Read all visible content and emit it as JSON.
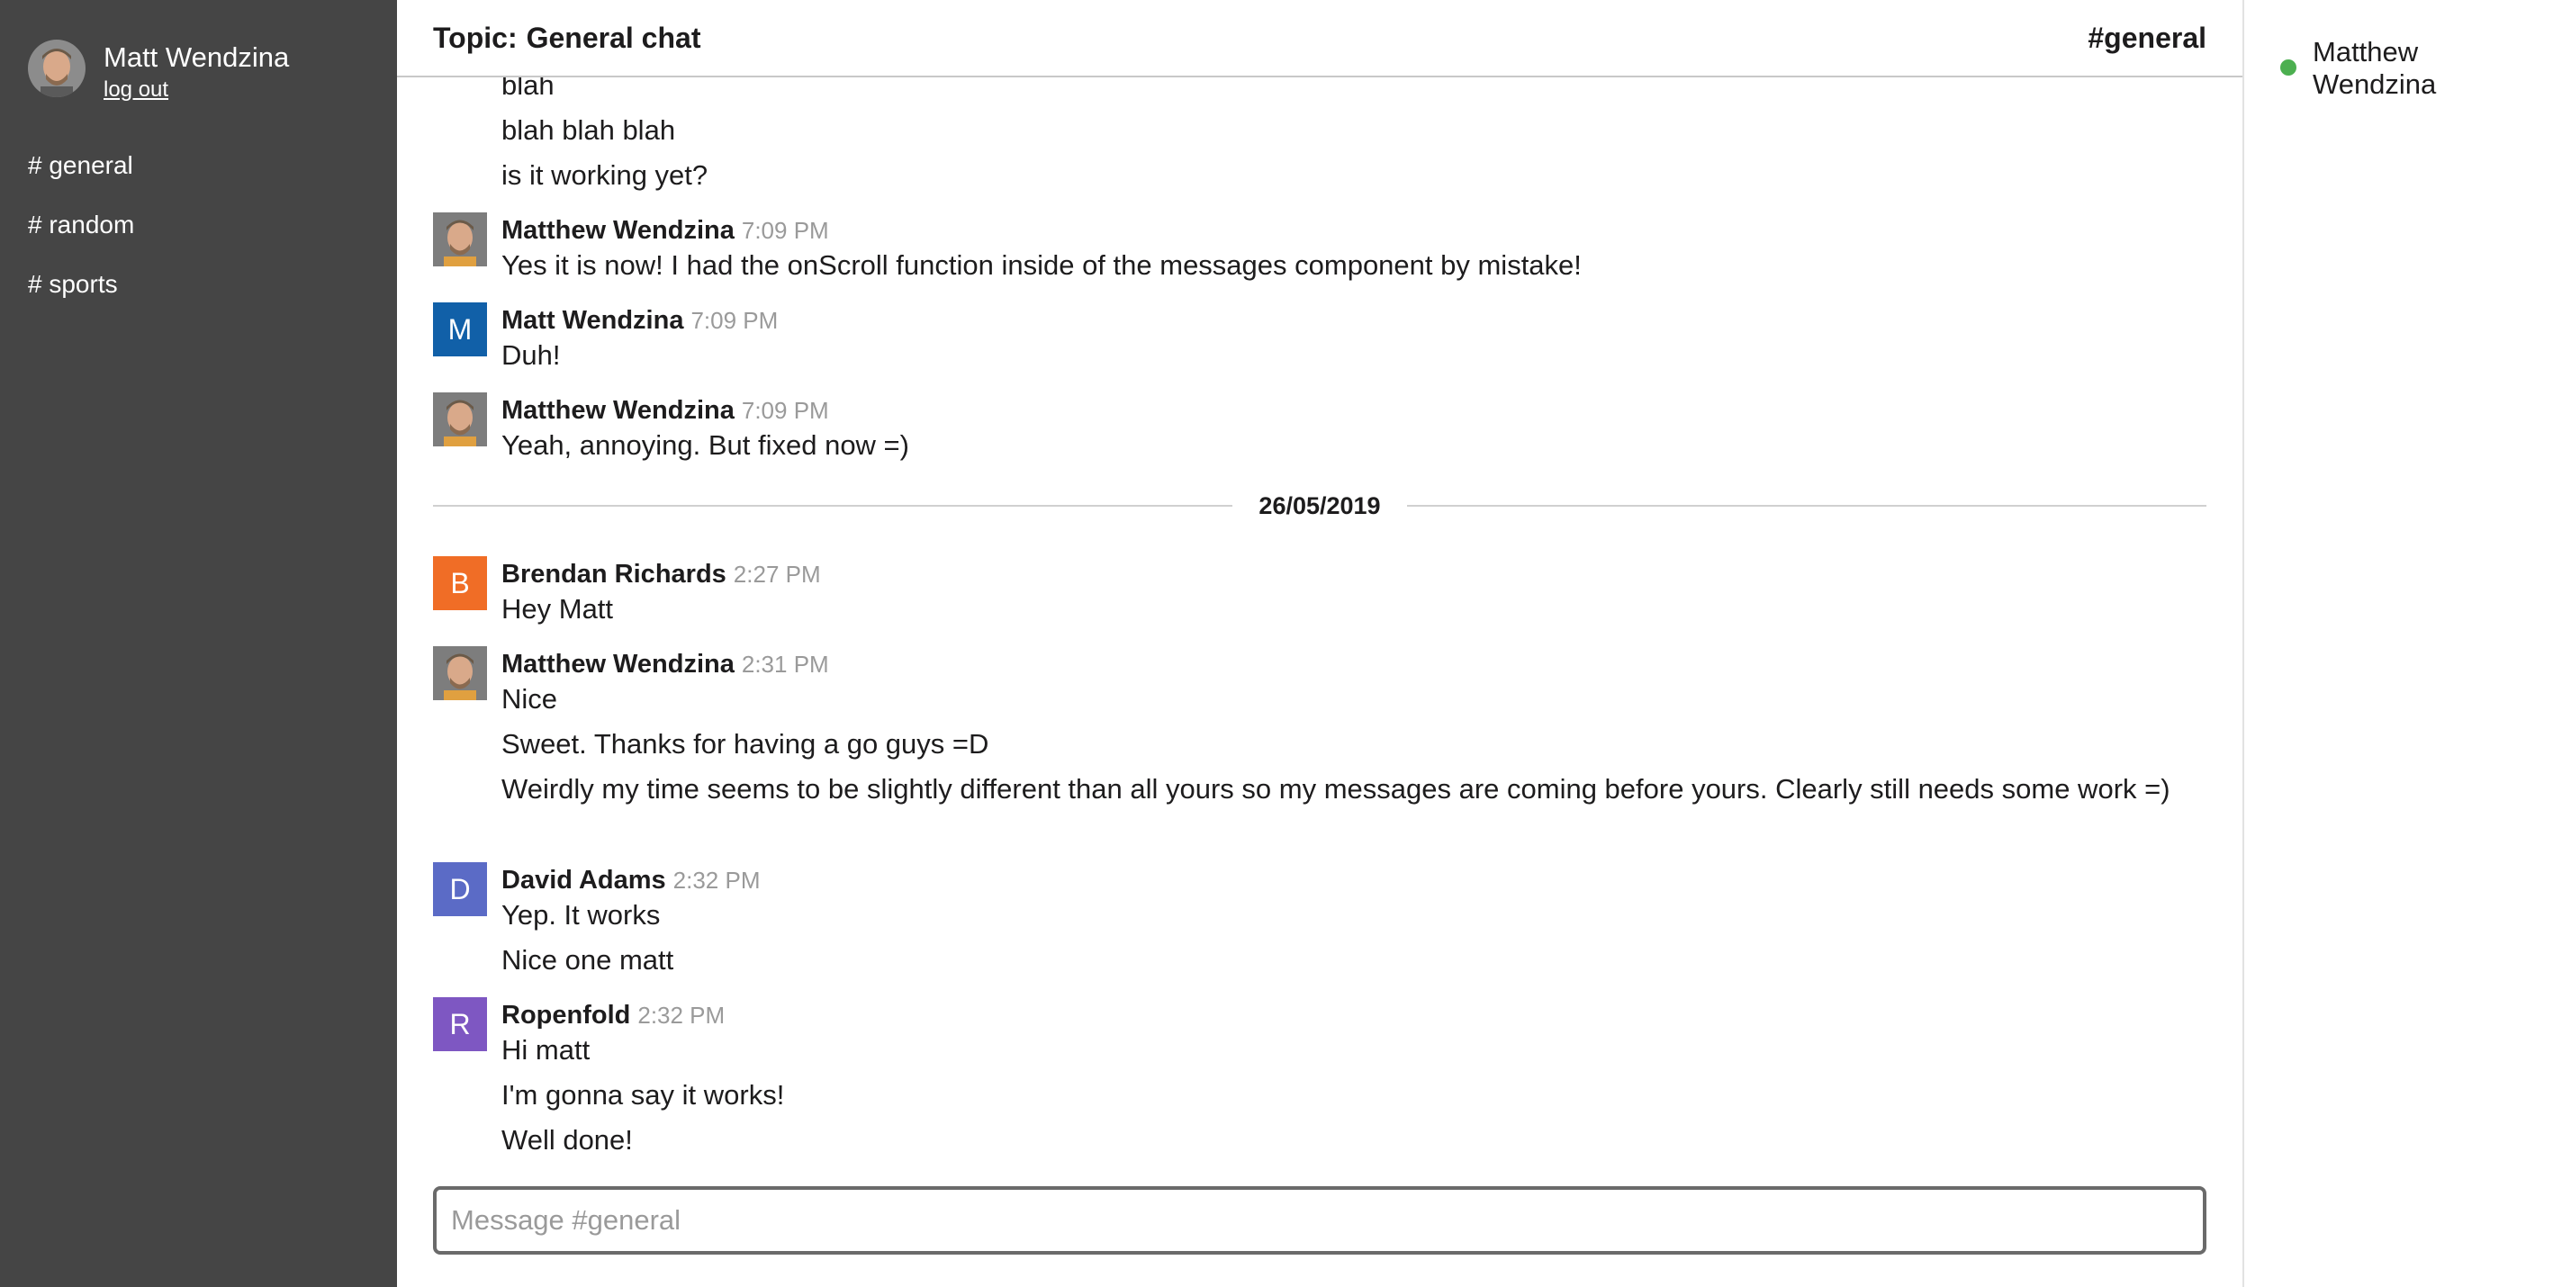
{
  "user": {
    "name": "Matt Wendzina",
    "logout_label": "log out"
  },
  "channels": [
    "# general",
    "# random",
    "# sports"
  ],
  "header": {
    "topic_label": "Topic:",
    "topic": "General chat",
    "channel": "#general"
  },
  "messages": {
    "cont1": [
      "blah",
      "blah blah blah",
      "is it working yet?"
    ],
    "g1": {
      "author": "Matthew Wendzina",
      "time": "7:09 PM",
      "lines": [
        "Yes it is now! I had the onScroll function inside of the messages component by mistake!"
      ]
    },
    "g2": {
      "author": "Matt Wendzina",
      "time": "7:09 PM",
      "initial": "M",
      "color": "#1160a8",
      "lines": [
        "Duh!"
      ]
    },
    "g3": {
      "author": "Matthew Wendzina",
      "time": "7:09 PM",
      "lines": [
        "Yeah, annoying. But fixed now =)"
      ]
    },
    "date_divider": "26/05/2019",
    "g4": {
      "author": "Brendan Richards",
      "time": "2:27 PM",
      "initial": "B",
      "color": "#f06d26",
      "lines": [
        "Hey Matt"
      ]
    },
    "g5": {
      "author": "Matthew Wendzina",
      "time": "2:31 PM",
      "lines": [
        "Nice",
        "Sweet. Thanks for having a go guys =D",
        "Weirdly my time seems to be slightly different than all yours so my messages are coming before yours. Clearly still needs some work =)"
      ]
    },
    "g6": {
      "author": "David Adams",
      "time": "2:32 PM",
      "initial": "D",
      "color": "#5b6bc6",
      "lines": [
        "Yep. It works",
        "Nice one matt"
      ]
    },
    "g7": {
      "author": "Ropenfold",
      "time": "2:32 PM",
      "initial": "R",
      "color": "#7e57c2",
      "lines": [
        "Hi matt",
        "I'm gonna say it works!",
        "Well done!"
      ]
    }
  },
  "composer": {
    "placeholder": "Message #general"
  },
  "members": [
    {
      "name": "Matthew Wendzina",
      "status": "online",
      "status_color": "#4caf50"
    }
  ],
  "icons": {
    "avatar_photo": "user-photo",
    "presence": "online-dot"
  }
}
